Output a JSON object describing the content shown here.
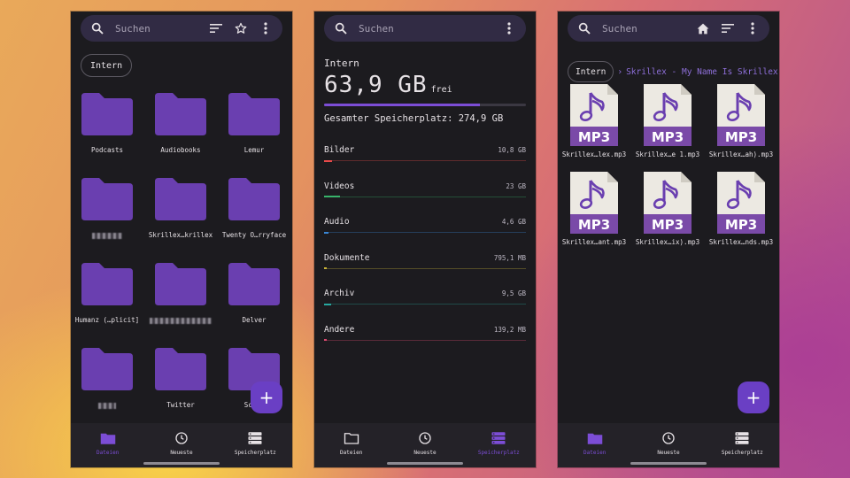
{
  "search_placeholder": "Suchen",
  "nav": {
    "files": "Dateien",
    "recent": "Neueste",
    "storage": "Speicherplatz"
  },
  "left": {
    "chip": "Intern",
    "folders": [
      {
        "label": "Podcasts"
      },
      {
        "label": "Audiobooks"
      },
      {
        "label": "Lemur"
      },
      {
        "label": ""
      },
      {
        "label": "Skrillex…krillex"
      },
      {
        "label": "Twenty O…rryface"
      },
      {
        "label": "Humanz (…plicit]"
      },
      {
        "label": ""
      },
      {
        "label": "Delver"
      },
      {
        "label": ""
      },
      {
        "label": "Twitter"
      },
      {
        "label": "Scree"
      }
    ]
  },
  "middle": {
    "label": "Intern",
    "free_value": "63,9 GB",
    "free_word": "frei",
    "used_fraction": 0.77,
    "total": "Gesamter Speicherplatz: 274,9 GB",
    "categories": [
      {
        "name": "Bilder",
        "size": "10,8 GB",
        "color": "#e84a4a",
        "fraction": 0.04
      },
      {
        "name": "Videos",
        "size": "23 GB",
        "color": "#38b36a",
        "fraction": 0.08
      },
      {
        "name": "Audio",
        "size": "4,6 GB",
        "color": "#3a86d4",
        "fraction": 0.02
      },
      {
        "name": "Dokumente",
        "size": "795,1 MB",
        "color": "#c9b338",
        "fraction": 0.005
      },
      {
        "name": "Archiv",
        "size": "9,5 GB",
        "color": "#27a8a0",
        "fraction": 0.035
      },
      {
        "name": "Andere",
        "size": "139,2 MB",
        "color": "#d9486e",
        "fraction": 0.003
      }
    ]
  },
  "right": {
    "crumb_root": "Intern",
    "crumb_current": "Skrillex - My Name Is Skrillex",
    "file_badge": "MP3",
    "files": [
      {
        "label": "Skrillex…lex.mp3"
      },
      {
        "label": "Skrillex…e 1.mp3"
      },
      {
        "label": "Skrillex…ah).mp3"
      },
      {
        "label": "Skrillex…ant.mp3"
      },
      {
        "label": "Skrillex…ix).mp3"
      },
      {
        "label": "Skrillex…nds.mp3"
      }
    ]
  },
  "colors": {
    "accent": "#7c4dd6",
    "folder": "#6a3fb0",
    "fab": "#6a3fc4"
  }
}
